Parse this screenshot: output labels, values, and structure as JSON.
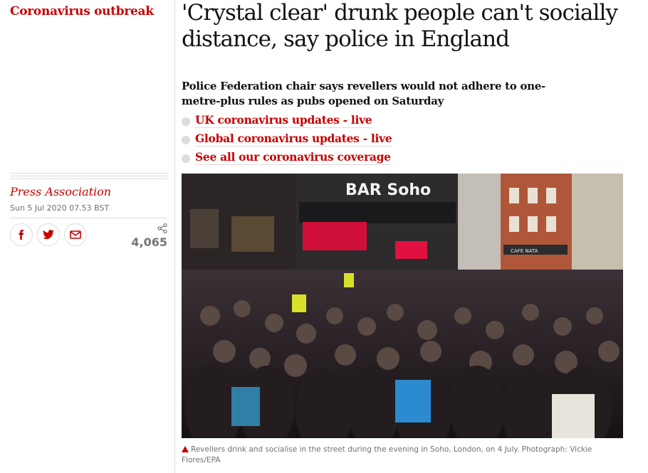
{
  "section": {
    "label": "Coronavirus outbreak"
  },
  "article": {
    "headline": "'Crystal clear' drunk people can't socially distance, say police in England",
    "standfirst": "Police Federation chair says revellers would not adhere to one-metre-plus rules as pubs opened on Saturday",
    "links": [
      {
        "label": "UK coronavirus updates - live"
      },
      {
        "label": "Global coronavirus updates - live"
      },
      {
        "label": "See all our coronavirus coverage"
      }
    ],
    "byline": "Press Association",
    "date": "Sun 5 Jul 2020 07.53 BST",
    "share": {
      "count": "4,065",
      "icons": [
        "facebook-icon",
        "twitter-icon",
        "email-icon",
        "share-count-icon"
      ]
    },
    "image": {
      "sign_text": "BAR Soho",
      "shop_sign": "CAFE NATA"
    },
    "caption": {
      "text": "Revellers drink and socialise in the street during the evening in Soho, London, on 4 July. Photograph: Vickie Flores/EPA"
    }
  },
  "colors": {
    "accent": "#c70000",
    "text": "#121212",
    "muted": "#707070",
    "rule": "#dcdcdc"
  }
}
